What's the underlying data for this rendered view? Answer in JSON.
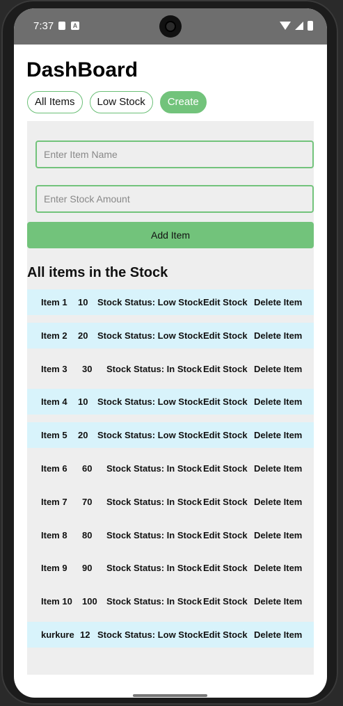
{
  "status_bar": {
    "time": "7:37",
    "badge_icon": "A"
  },
  "header": {
    "title": "DashBoard"
  },
  "tabs": [
    {
      "label": "All Items"
    },
    {
      "label": "Low Stock"
    },
    {
      "label": "Create"
    }
  ],
  "form": {
    "name_placeholder": "Enter Item Name",
    "amount_placeholder": "Enter Stock Amount",
    "add_label": "Add Item"
  },
  "list": {
    "title": "All items in the Stock",
    "edit_label": "Edit Stock",
    "delete_label": "Delete Item",
    "items": [
      {
        "name": "Item 1",
        "qty": "10",
        "status": "Stock Status: Low Stock",
        "low": true
      },
      {
        "name": "Item 2",
        "qty": "20",
        "status": "Stock Status: Low Stock",
        "low": true
      },
      {
        "name": "Item 3",
        "qty": "30",
        "status": "Stock Status: In Stock",
        "low": false
      },
      {
        "name": "Item 4",
        "qty": "10",
        "status": "Stock Status: Low Stock",
        "low": true
      },
      {
        "name": "Item 5",
        "qty": "20",
        "status": "Stock Status: Low Stock",
        "low": true
      },
      {
        "name": "Item 6",
        "qty": "60",
        "status": "Stock Status: In Stock",
        "low": false
      },
      {
        "name": "Item 7",
        "qty": "70",
        "status": "Stock Status: In Stock",
        "low": false
      },
      {
        "name": "Item 8",
        "qty": "80",
        "status": "Stock Status: In Stock",
        "low": false
      },
      {
        "name": "Item 9",
        "qty": "90",
        "status": "Stock Status: In Stock",
        "low": false
      },
      {
        "name": "Item 10",
        "qty": "100",
        "status": "Stock Status: In Stock",
        "low": false
      },
      {
        "name": "kurkure",
        "qty": "12",
        "status": "Stock Status: Low Stock",
        "low": true
      }
    ]
  },
  "colors": {
    "accent": "#72c37b",
    "low_row": "#d8f3fb",
    "panel": "#eeeeee"
  }
}
